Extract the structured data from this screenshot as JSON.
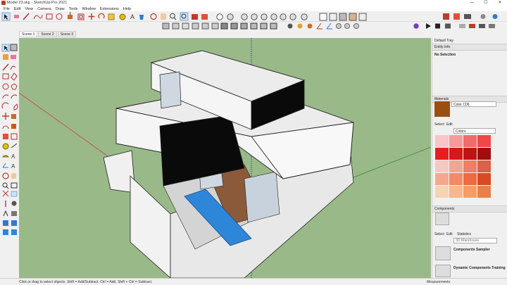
{
  "window": {
    "title": "Model 23.skp - SketchUp Pro 2021",
    "minimize": "—",
    "maximize": "☐",
    "close": "✕"
  },
  "menu": [
    "File",
    "Edit",
    "View",
    "Camera",
    "Draw",
    "Tools",
    "Window",
    "Extensions",
    "Help"
  ],
  "scenes": [
    "Scene 1",
    "Scene 2",
    "Scene 3"
  ],
  "status": {
    "hint": "Click or drag to select objects. Shift = Add/Subtract. Ctrl = Add. Shift + Ctrl = Subtract.",
    "measurements_label": "Measurements"
  },
  "tray": {
    "title": "Default Tray",
    "entity_info": {
      "header": "Entity Info",
      "selection": "No Selection"
    },
    "materials": {
      "header": "Materials",
      "current_name": "Color C06",
      "current_color": "#9a4f10",
      "tabs": [
        "Select",
        "Edit"
      ],
      "library": "Colors",
      "swatches": [
        "#f7c6c6",
        "#f59a9a",
        "#f26b6b",
        "#f04848",
        "#e81e1e",
        "#d81818",
        "#c01414",
        "#a00e0e",
        "#f6c9c0",
        "#f2a592",
        "#ed7f68",
        "#d8624a",
        "#f5a890",
        "#f28a6a",
        "#ee6a42",
        "#d84a26",
        "#f8d2b5",
        "#f6b88e",
        "#f39e68",
        "#e88048"
      ]
    },
    "components": {
      "header": "Components",
      "tabs": [
        "Select",
        "Edit",
        "Statistics"
      ],
      "search_placeholder": "3D Warehouse",
      "items": [
        "Components Sampler",
        "Dynamic Components Training"
      ]
    }
  },
  "accent_colors": {
    "sky": "#ffffff",
    "ground": "#9ab989",
    "pool": "#2e86d8",
    "deck": "#8a5a3a"
  }
}
